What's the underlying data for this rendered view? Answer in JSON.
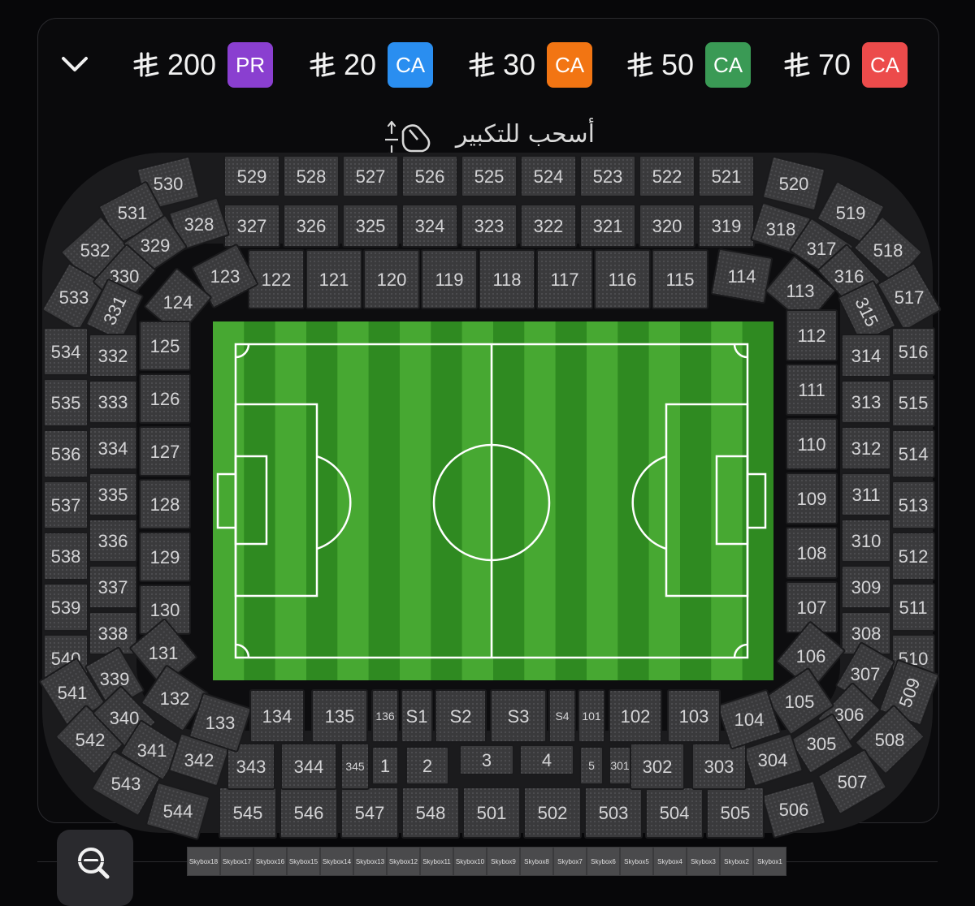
{
  "header": {
    "collapse_icon": "chevron-down-icon",
    "currency_icon": "riyal-icon",
    "prices": [
      {
        "amount": "200",
        "badge": "PR",
        "color": "#8a3fd0"
      },
      {
        "amount": "20",
        "badge": "CA",
        "color": "#2a8ef0"
      },
      {
        "amount": "30",
        "badge": "CA",
        "color": "#f27513"
      },
      {
        "amount": "50",
        "badge": "CA",
        "color": "#3a9a55"
      },
      {
        "amount": "70",
        "badge": "CA",
        "color": "#ec4b4b"
      }
    ]
  },
  "hint": {
    "text": "أسحب للتكبير",
    "icon": "pinch-zoom-icon"
  },
  "colors": {
    "section_fill": "#3a3a3c",
    "section_dim": "#303032",
    "section_stroke": "#1a1a1c",
    "grass_light": "#47a832",
    "grass_dark": "#2f8a21",
    "pitch_line": "#ffffff"
  },
  "sections": {
    "ring5_top": [
      "529",
      "528",
      "527",
      "526",
      "525",
      "524",
      "523",
      "522",
      "521"
    ],
    "ring5_corner_tl": [
      "530",
      "531",
      "532",
      "533"
    ],
    "ring5_corner_tr": [
      "520",
      "519",
      "518",
      "517"
    ],
    "ring5_left": [
      "534",
      "535",
      "536",
      "537",
      "538",
      "539",
      "540"
    ],
    "ring5_right": [
      "516",
      "515",
      "514",
      "513",
      "512",
      "511",
      "510"
    ],
    "ring5_corner_bl": [
      "541",
      "542",
      "543",
      "544"
    ],
    "ring5_corner_br": [
      "509",
      "508",
      "507",
      "506"
    ],
    "ring5_bottom": [
      "545",
      "546",
      "547",
      "548",
      "501",
      "502",
      "503",
      "504",
      "505"
    ],
    "ring3_top": [
      "327",
      "326",
      "325",
      "324",
      "323",
      "322",
      "321",
      "320",
      "319"
    ],
    "ring3_corner_tl": [
      "328",
      "329",
      "330",
      "331"
    ],
    "ring3_corner_tr": [
      "318",
      "317",
      "316",
      "315"
    ],
    "ring3_left": [
      "332",
      "333",
      "334",
      "335",
      "336",
      "337",
      "338"
    ],
    "ring3_right": [
      "314",
      "313",
      "312",
      "311",
      "310",
      "309",
      "308"
    ],
    "ring3_corner_bl": [
      "339",
      "340",
      "341",
      "342"
    ],
    "ring3_corner_br": [
      "307",
      "306",
      "305",
      "304"
    ],
    "ring3_bottom": [
      "343",
      "344",
      "345",
      "302",
      "303"
    ],
    "ring1_top": [
      "122",
      "121",
      "120",
      "119",
      "118",
      "117",
      "116",
      "115"
    ],
    "ring1_corner_tl": [
      "123",
      "124"
    ],
    "ring1_corner_tr": [
      "114",
      "113"
    ],
    "ring1_left": [
      "125",
      "126",
      "127",
      "128",
      "129",
      "130"
    ],
    "ring1_right": [
      "112",
      "111",
      "110",
      "109",
      "108",
      "107"
    ],
    "ring1_corner_bl": [
      "131",
      "132",
      "133"
    ],
    "ring1_corner_br": [
      "106",
      "105",
      "104"
    ],
    "ring1_bottom": [
      "134",
      "135",
      "136",
      "S1",
      "S2",
      "S3",
      "S4",
      "101",
      "102",
      "103"
    ],
    "vip_boxes": [
      "1",
      "2",
      "3",
      "4",
      "5",
      "301"
    ]
  },
  "skyboxes": [
    "Skybox18",
    "Skybox17",
    "Skybox16",
    "Skybox15",
    "Skybox14",
    "Skybox13",
    "Skybox12",
    "Skybox11",
    "Skybox10",
    "Skybox9",
    "Skybox8",
    "Skybox7",
    "Skybox6",
    "Skybox5",
    "Skybox4",
    "Skybox3",
    "Skybox2",
    "Skybox1"
  ],
  "zoom_out_icon": "zoom-out-icon"
}
